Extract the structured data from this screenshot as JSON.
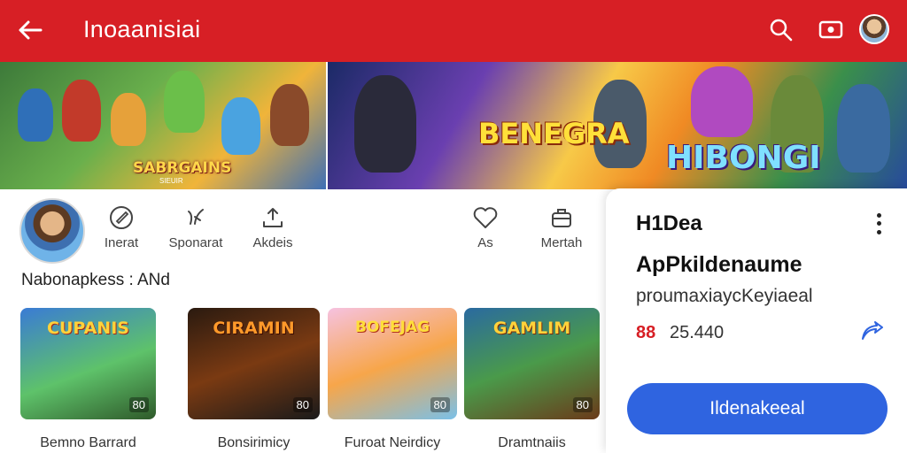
{
  "header": {
    "title": "Inoaanisiai",
    "bg_color": "#d71f25",
    "icons": [
      "back-arrow-icon",
      "search-icon",
      "cast-icon",
      "avatar"
    ]
  },
  "banners": {
    "left": {
      "logo": "SABRGAINS",
      "sub": "SIEUIR"
    },
    "right": {
      "logo1": "BENEGRA",
      "logo2": "HIBONGI"
    }
  },
  "actions": [
    {
      "label": "Inerat",
      "icon": "edit-icon"
    },
    {
      "label": "Sponarat",
      "icon": "sparkle-icon"
    },
    {
      "label": "Akdeis",
      "icon": "share-icon"
    },
    {
      "label": "As",
      "icon": "heart-icon"
    },
    {
      "label": "Mertah",
      "icon": "store-icon"
    }
  ],
  "section": {
    "title": "Nabonapkess : ANd"
  },
  "cards": [
    {
      "name": "Bemno Barrard",
      "thumb_title": "CUPANIS",
      "rating": "80"
    },
    {
      "name": "Bonsirimicy",
      "thumb_title": "CIRAMIN",
      "rating": "80"
    },
    {
      "name": "Furoat Neirdicy",
      "thumb_title": "BOFEJAG",
      "rating": "80"
    },
    {
      "name": "Dramtnaiis",
      "thumb_title": "GAMLIM",
      "rating": "80"
    }
  ],
  "panel": {
    "title": "H1Dea",
    "app_name": "ApPkildenaume",
    "subtitle": "proumaxiaycKeyiaeal",
    "stat_icon": "88",
    "stat_value": "25.440",
    "cta": "Ildenakeeal",
    "cta_color": "#2f64e0"
  }
}
